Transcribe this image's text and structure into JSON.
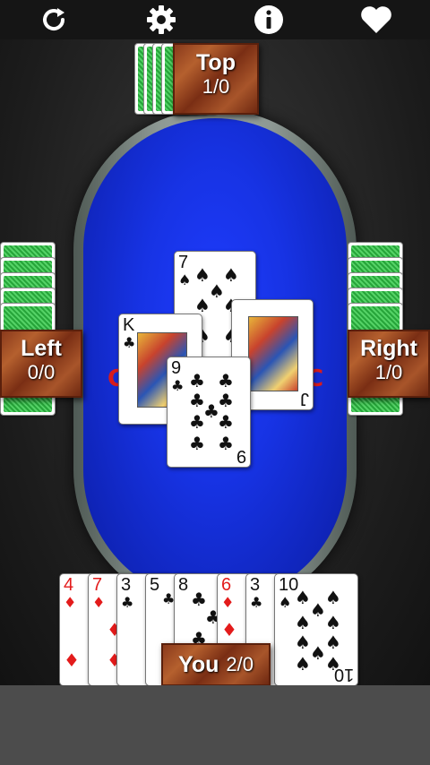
{
  "toolbar": {
    "icons": [
      "refresh-icon",
      "settings-gear-icon",
      "info-icon",
      "heart-icon"
    ]
  },
  "players": {
    "top": {
      "name": "Top",
      "score": "1/0"
    },
    "left": {
      "name": "Left",
      "score": "0/0"
    },
    "right": {
      "name": "Right",
      "score": "1/0"
    },
    "you": {
      "name": "You",
      "score": "2/0"
    }
  },
  "trick": [
    {
      "rank": "7",
      "suit": "♠",
      "color": "black"
    },
    {
      "rank": "K",
      "suit": "♣",
      "color": "black"
    },
    {
      "rank": "J",
      "suit": "♣",
      "color": "black"
    },
    {
      "rank": "9",
      "suit": "♣",
      "color": "black"
    }
  ],
  "hand": [
    {
      "rank": "4",
      "suit": "♦",
      "color": "red"
    },
    {
      "rank": "7",
      "suit": "♦",
      "color": "red"
    },
    {
      "rank": "3",
      "suit": "♣",
      "color": "black"
    },
    {
      "rank": "5",
      "suit": "♣",
      "color": "black"
    },
    {
      "rank": "8",
      "suit": "♣",
      "color": "black"
    },
    {
      "rank": "6",
      "suit": "♦",
      "color": "red"
    },
    {
      "rank": "3",
      "suit": "♣",
      "color": "black"
    },
    {
      "rank": "10",
      "suit": "♠",
      "color": "black"
    }
  ],
  "colors": {
    "felt": "#1733e4",
    "card_back": "#27a53a",
    "plate_wood": "#8a3a1c",
    "red_suit": "#e31b1b"
  }
}
